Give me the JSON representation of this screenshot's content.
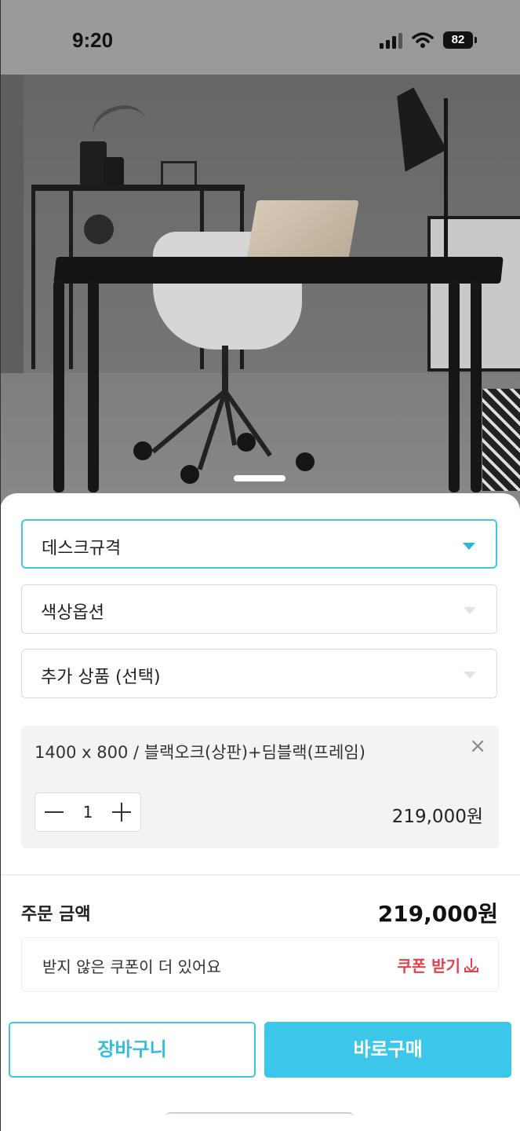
{
  "status_bar": {
    "time": "9:20",
    "battery": "82"
  },
  "options": {
    "desk_size": "데스크규격",
    "color": "색상옵션",
    "extra": "추가 상품 (선택)"
  },
  "selected_item": {
    "name": "1400 x 800 / 블랙오크(상판)+딤블랙(프레임)",
    "quantity": "1",
    "price": "219,000원",
    "remove_symbol": "×"
  },
  "order": {
    "total_label": "주문 금액",
    "total_value": "219,000원"
  },
  "coupon": {
    "message": "받지 않은 쿠폰이 더 있어요",
    "button_label": "쿠폰 받기"
  },
  "actions": {
    "cart_label": "장바구니",
    "buy_label": "바로구매"
  },
  "colors": {
    "accent": "#3cc6ea",
    "coupon_red": "#e0434d"
  },
  "icons": [
    "signal-icon",
    "wifi-icon",
    "battery-icon",
    "chevron-down-icon",
    "close-icon",
    "minus-icon",
    "plus-icon",
    "download-icon"
  ]
}
